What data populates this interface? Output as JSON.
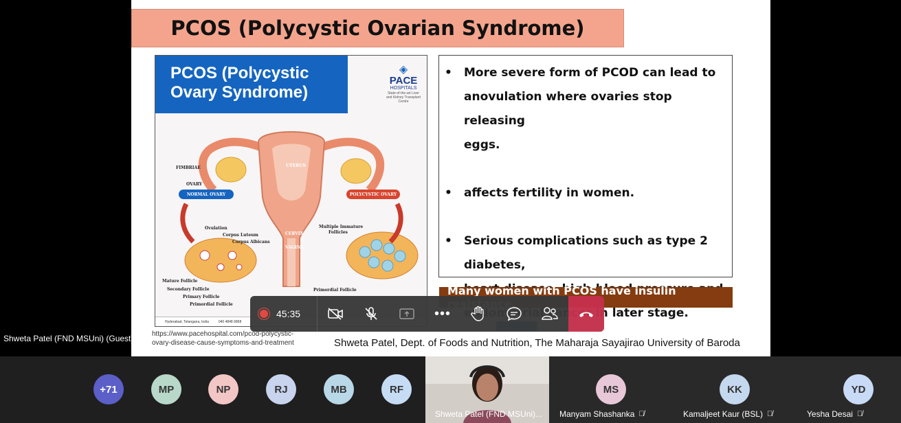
{
  "meeting": {
    "presenter_label": "Shweta Patel (FND MSUni) (Guest)",
    "timer": "45:35"
  },
  "slide": {
    "title": "PCOS (Polycystic Ovarian Syndrome)",
    "infographic": {
      "header_line1": "PCOS (Polycystic",
      "header_line2": "Ovary Syndrome)",
      "logo_name_1": "PACE",
      "logo_name_2": "HOSPITALS",
      "logo_tag": "State-of-the-art Liver and Kidney Transplant Centre",
      "labels": {
        "fimbriae": "FIMBRIAE",
        "ovary": "OVARY",
        "uterus": "UTERUS",
        "cervix": "CERVIX",
        "vagina": "VAGINA",
        "normal_ovary": "NORMAL OVARY",
        "polycystic_ovary": "POLYCYSTIC OVARY",
        "ovulation": "Ovulation",
        "corpus_luteum": "Corpus Luteum",
        "corpus_albicans": "Corpus Albicans",
        "mature_follicle": "Mature Follicle",
        "secondary_follicle": "Secondary Follicle",
        "primary_follicle": "Primary Follicle",
        "primordial_follicle": "Primordial Follicle",
        "multiple_immature": "Multiple Immature",
        "follicles": "Follicles",
        "primordial_follicle_2": "Primordial Follicle"
      },
      "footer_location": "Hyderabad, Telangana, India",
      "footer_phone": "040 4848 6868"
    },
    "bullets": [
      {
        "lines": [
          "More severe form of PCOD can lead to",
          "anovulation where ovaries stop releasing",
          "eggs."
        ]
      },
      {
        "lines": [
          "affects fertility in women."
        ]
      },
      {
        "lines": [
          "Serious complications such as type 2 diabetes,",
          "heart disease, high-blood pressure and",
          "endometrial cancer in later stage."
        ]
      }
    ],
    "insulin_banner": "Many women with PCOS have insulin resistance.",
    "url_line1": "https://www.pacehospital.com/pcod-polycystic-",
    "url_line2": "ovary-disease-cause-symptoms-and-treatment",
    "credit": "Shweta Patel, Dept. of Foods and Nutrition, The Maharaja Sayajirao University of Baroda"
  },
  "toolbar": {
    "buttons": [
      "camera-off",
      "mic-off",
      "share-screen",
      "more",
      "raise-hand",
      "chat",
      "participants",
      "hang-up"
    ]
  },
  "participants": {
    "overflow": "+71",
    "initials": [
      {
        "text": "MP",
        "color": "#b8d8c9"
      },
      {
        "text": "NP",
        "color": "#f3c6c6"
      },
      {
        "text": "RJ",
        "color": "#c8d4ee"
      },
      {
        "text": "MB",
        "color": "#b8d8e8"
      },
      {
        "text": "RF",
        "color": "#c6dcf4"
      }
    ],
    "overflow_color": "#5b5fc7",
    "video_name": "Shweta Patel (FND MSUni)...",
    "named": [
      {
        "initials": "MS",
        "name": "Manyam Shashanka",
        "color": "#e8c8d8"
      },
      {
        "initials": "KK",
        "name": "Kamaljeet Kaur (BSL)",
        "color": "#c4d8ee"
      },
      {
        "initials": "YD",
        "name": "Yesha Desai",
        "color": "#c8daf6"
      }
    ]
  }
}
